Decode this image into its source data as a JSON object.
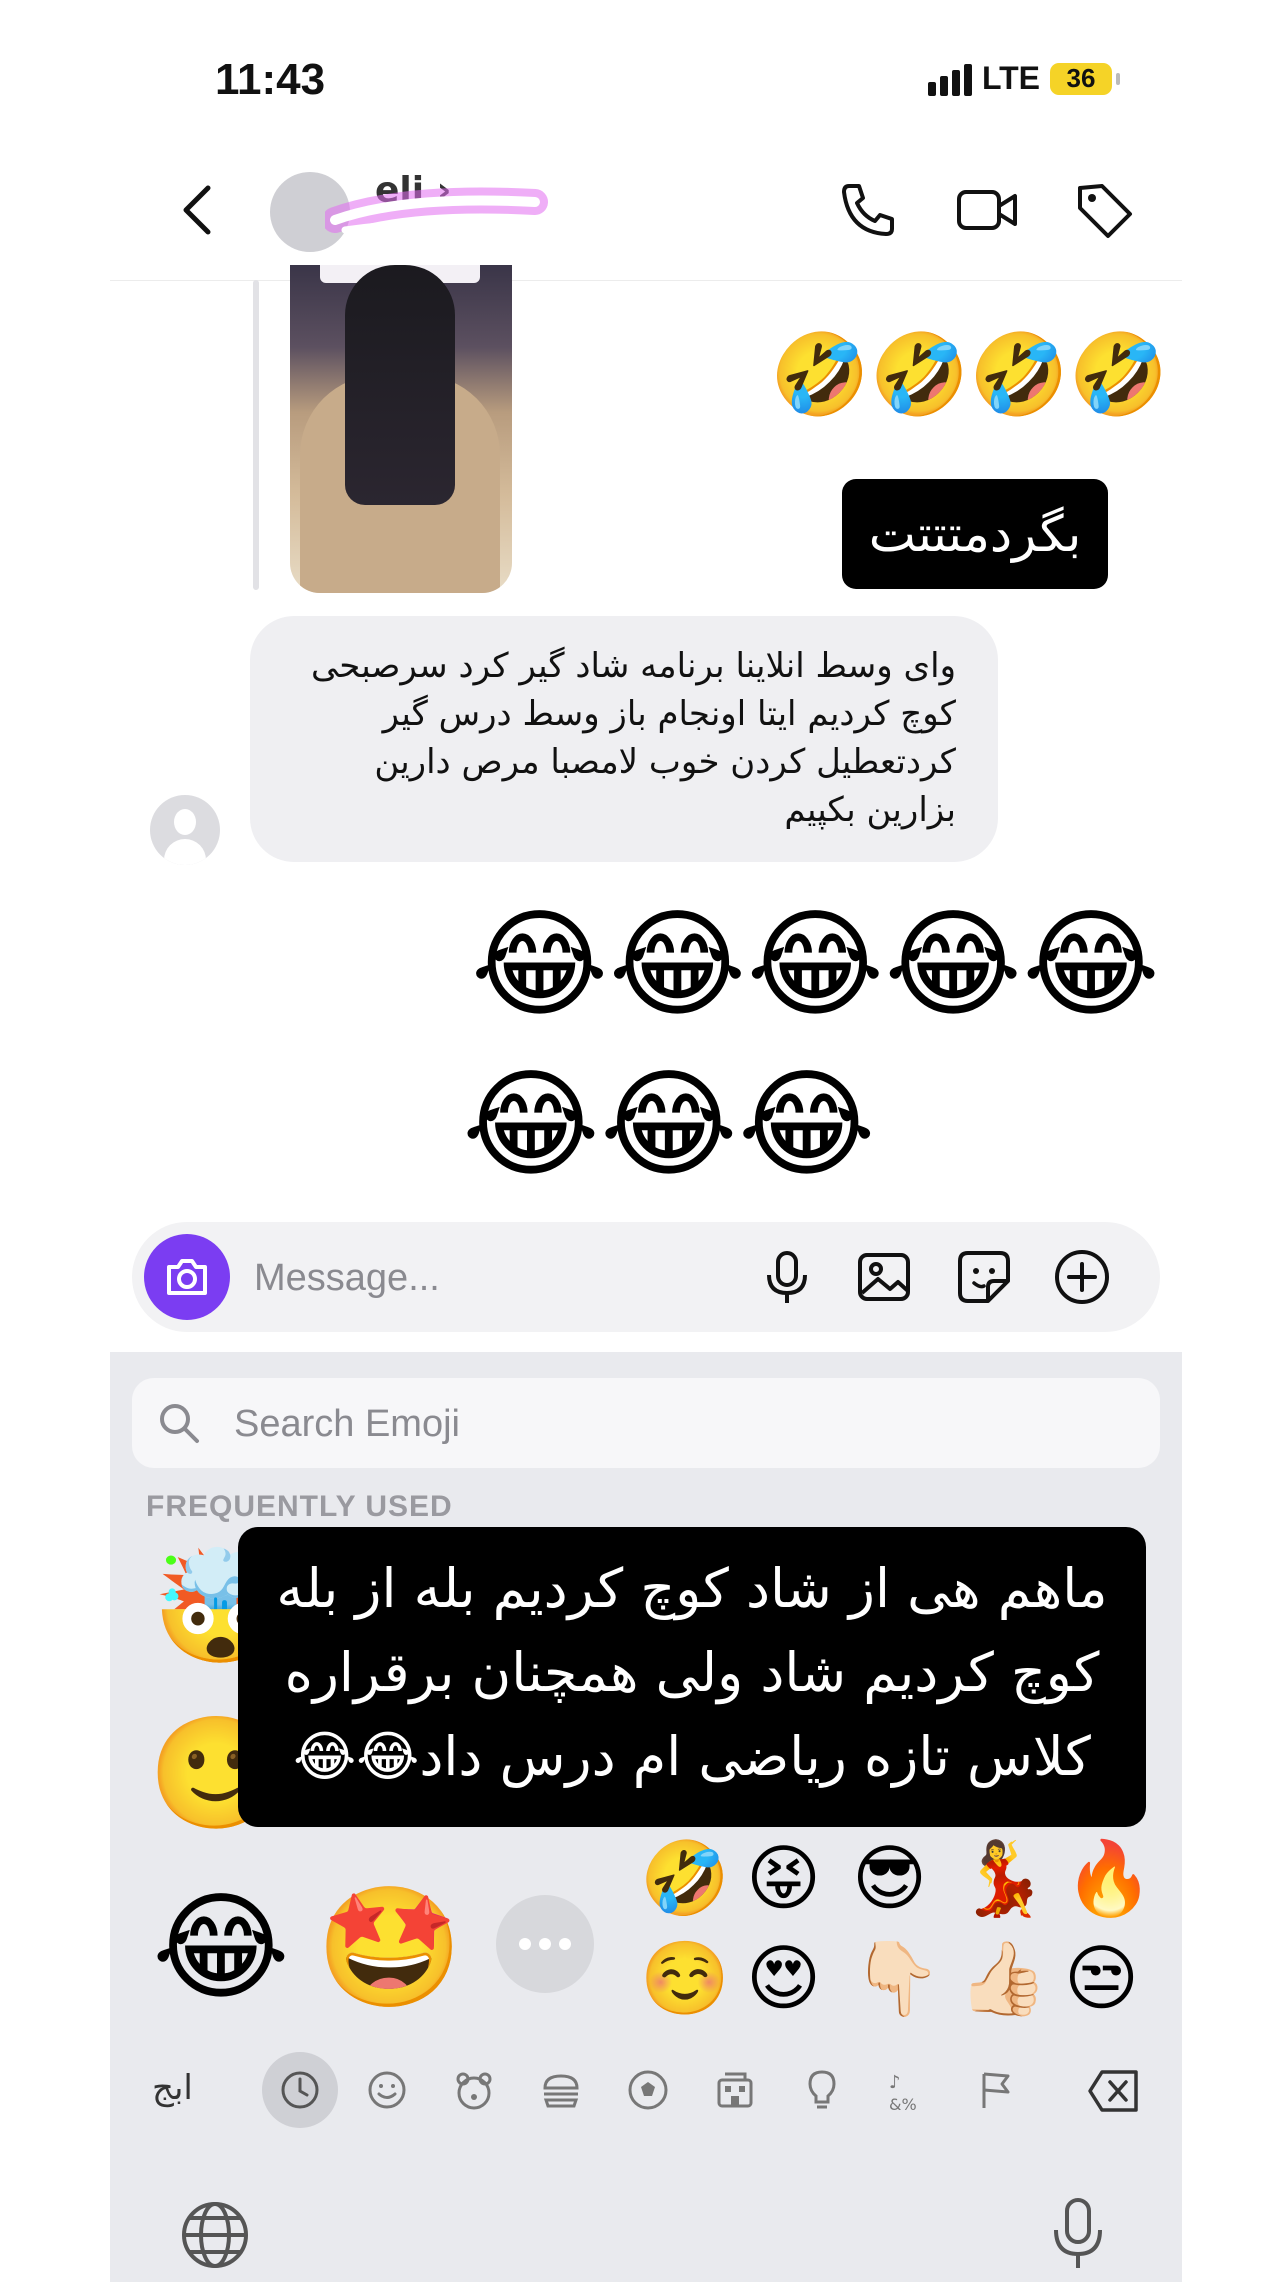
{
  "status_bar": {
    "time": "11:43",
    "network": "LTE",
    "battery": "36"
  },
  "header": {
    "contact_name": "eli",
    "back_icon": "chevron-left-icon",
    "call_icon": "phone-icon",
    "video_icon": "video-camera-icon",
    "tag_icon": "tag-icon"
  },
  "chat": {
    "reply_emojis": "🤣🤣🤣🤣",
    "sticker_text": "بگردمتتتت",
    "incoming_message_lines": [
      "وای وسط انلاینا برنامه شاد گیر کرد سرصبحی",
      "کوچ کردیم ایتا اونجام باز وسط درس گیر",
      "کردتعطیل کردن خوب لامصبا مرص دارین",
      "بزارین بکپیم"
    ],
    "laugh_row_1": "😂😂😂😂😂",
    "laugh_row_2": "😂😂😂"
  },
  "composer": {
    "placeholder": "Message...",
    "icons": [
      "camera-icon",
      "microphone-icon",
      "image-icon",
      "sticker-icon",
      "plus-circle-icon"
    ]
  },
  "keyboard": {
    "search_placeholder": "Search Emoji",
    "section_label": "FREQUENTLY USED",
    "overlay_text_lines": [
      "ماهم هی از شاد کوچ کردیم بله از بله",
      "کوچ کردیم شاد ولی همچنان برقراره",
      "کلاس تازه ریاضی ام درس داد😂😂"
    ],
    "emoji_row_1": [
      "🤣",
      "😝",
      "😎",
      "💃",
      "🔥"
    ],
    "emoji_row_2": [
      "☺️",
      "😍",
      "👇🏻",
      "👍🏻",
      "😒"
    ],
    "memoji": [
      "🤯",
      "🙂",
      "😂",
      "🤩"
    ],
    "abc_label": "ابج",
    "category_icons": [
      "clock-icon",
      "smiley-icon",
      "bear-icon",
      "burger-icon",
      "soccer-ball-icon",
      "building-icon",
      "lightbulb-icon",
      "symbols-icon",
      "flag-icon",
      "delete-icon"
    ],
    "globe_icon": "globe-icon",
    "dictation_icon": "microphone-icon"
  },
  "colors": {
    "accent": "#7B3DF2",
    "bubble": "#EFEFF2",
    "keyboard_bg": "#E9EAEE",
    "battery": "#F5D327"
  }
}
